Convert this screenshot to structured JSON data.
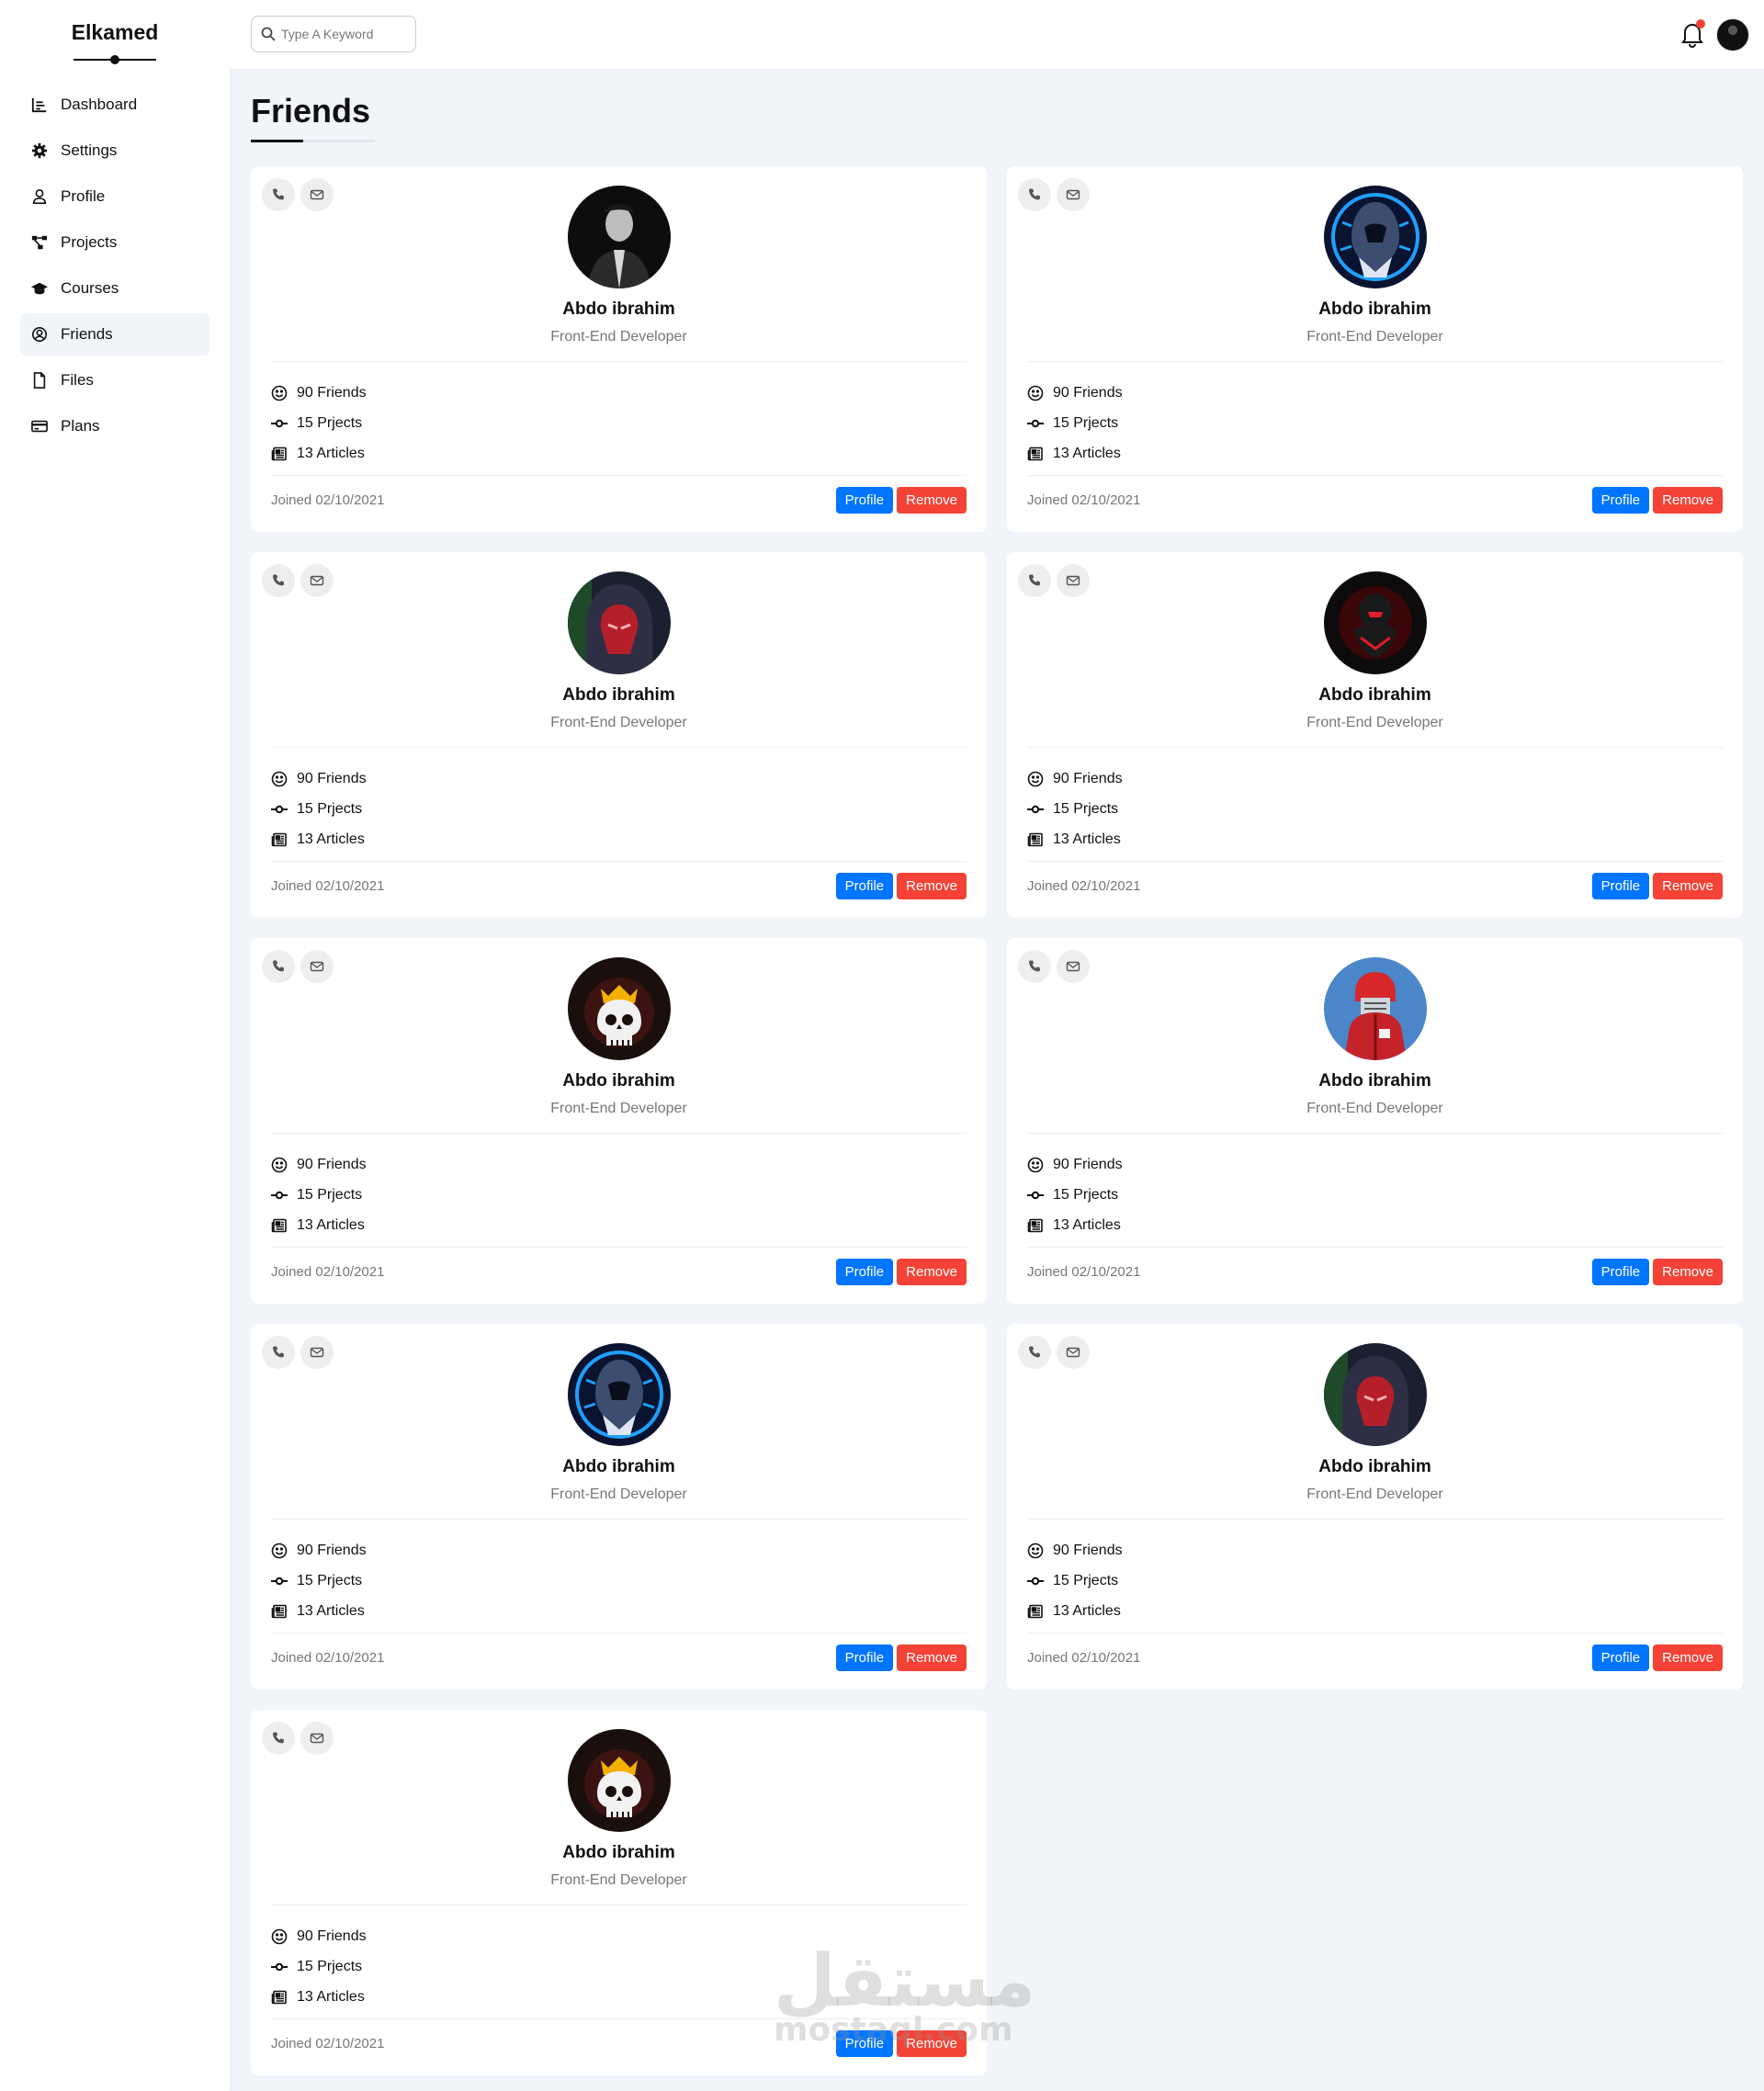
{
  "brand": "Elkamed",
  "nav": [
    {
      "label": "Dashboard",
      "icon": "chart-icon",
      "active": false
    },
    {
      "label": "Settings",
      "icon": "gear-icon",
      "active": false
    },
    {
      "label": "Profile",
      "icon": "user-icon",
      "active": false
    },
    {
      "label": "Projects",
      "icon": "diagram-icon",
      "active": false
    },
    {
      "label": "Courses",
      "icon": "graduation-cap-icon",
      "active": false
    },
    {
      "label": "Friends",
      "icon": "user-circle-icon",
      "active": true
    },
    {
      "label": "Files",
      "icon": "file-icon",
      "active": false
    },
    {
      "label": "Plans",
      "icon": "credit-card-icon",
      "active": false
    }
  ],
  "header": {
    "search_placeholder": "Type A Keyword",
    "notification_badge_color": "#f44336"
  },
  "page": {
    "title": "Friends"
  },
  "cards": [
    {
      "name": "Abdo ibrahim",
      "role": "Front-End Developer",
      "friends": "90 Friends",
      "projects": "15 Prjects",
      "articles": "13 Articles",
      "joined": "Joined 02/10/2021",
      "profile_label": "Profile",
      "remove_label": "Remove",
      "avatar": "man-photo"
    },
    {
      "name": "Abdo ibrahim",
      "role": "Front-End Developer",
      "friends": "90 Friends",
      "projects": "15 Prjects",
      "articles": "13 Articles",
      "joined": "Joined 02/10/2021",
      "profile_label": "Profile",
      "remove_label": "Remove",
      "avatar": "blue-hooded-assassin"
    },
    {
      "name": "Abdo ibrahim",
      "role": "Front-End Developer",
      "friends": "90 Friends",
      "projects": "15 Prjects",
      "articles": "13 Articles",
      "joined": "Joined 02/10/2021",
      "profile_label": "Profile",
      "remove_label": "Remove",
      "avatar": "red-masked-hood"
    },
    {
      "name": "Abdo ibrahim",
      "role": "Front-End Developer",
      "friends": "90 Friends",
      "projects": "15 Prjects",
      "articles": "13 Articles",
      "joined": "Joined 02/10/2021",
      "profile_label": "Profile",
      "remove_label": "Remove",
      "avatar": "red-dark-knight"
    },
    {
      "name": "Abdo ibrahim",
      "role": "Front-End Developer",
      "friends": "90 Friends",
      "projects": "15 Prjects",
      "articles": "13 Articles",
      "joined": "Joined 02/10/2021",
      "profile_label": "Profile",
      "remove_label": "Remove",
      "avatar": "crowned-skull"
    },
    {
      "name": "Abdo ibrahim",
      "role": "Front-End Developer",
      "friends": "90 Friends",
      "projects": "15 Prjects",
      "articles": "13 Articles",
      "joined": "Joined 02/10/2021",
      "profile_label": "Profile",
      "remove_label": "Remove",
      "avatar": "red-armored-gamer"
    },
    {
      "name": "Abdo ibrahim",
      "role": "Front-End Developer",
      "friends": "90 Friends",
      "projects": "15 Prjects",
      "articles": "13 Articles",
      "joined": "Joined 02/10/2021",
      "profile_label": "Profile",
      "remove_label": "Remove",
      "avatar": "blue-hooded-assassin"
    },
    {
      "name": "Abdo ibrahim",
      "role": "Front-End Developer",
      "friends": "90 Friends",
      "projects": "15 Prjects",
      "articles": "13 Articles",
      "joined": "Joined 02/10/2021",
      "profile_label": "Profile",
      "remove_label": "Remove",
      "avatar": "red-masked-hood"
    },
    {
      "name": "Abdo ibrahim",
      "role": "Front-End Developer",
      "friends": "90 Friends",
      "projects": "15 Prjects",
      "articles": "13 Articles",
      "joined": "Joined 02/10/2021",
      "profile_label": "Profile",
      "remove_label": "Remove",
      "avatar": "crowned-skull"
    }
  ],
  "watermark": {
    "arabic": "مستقل",
    "latin": "mostaql.com"
  },
  "colors": {
    "primary": "#0075ff",
    "danger": "#f44336",
    "background": "#f1f5f9"
  }
}
